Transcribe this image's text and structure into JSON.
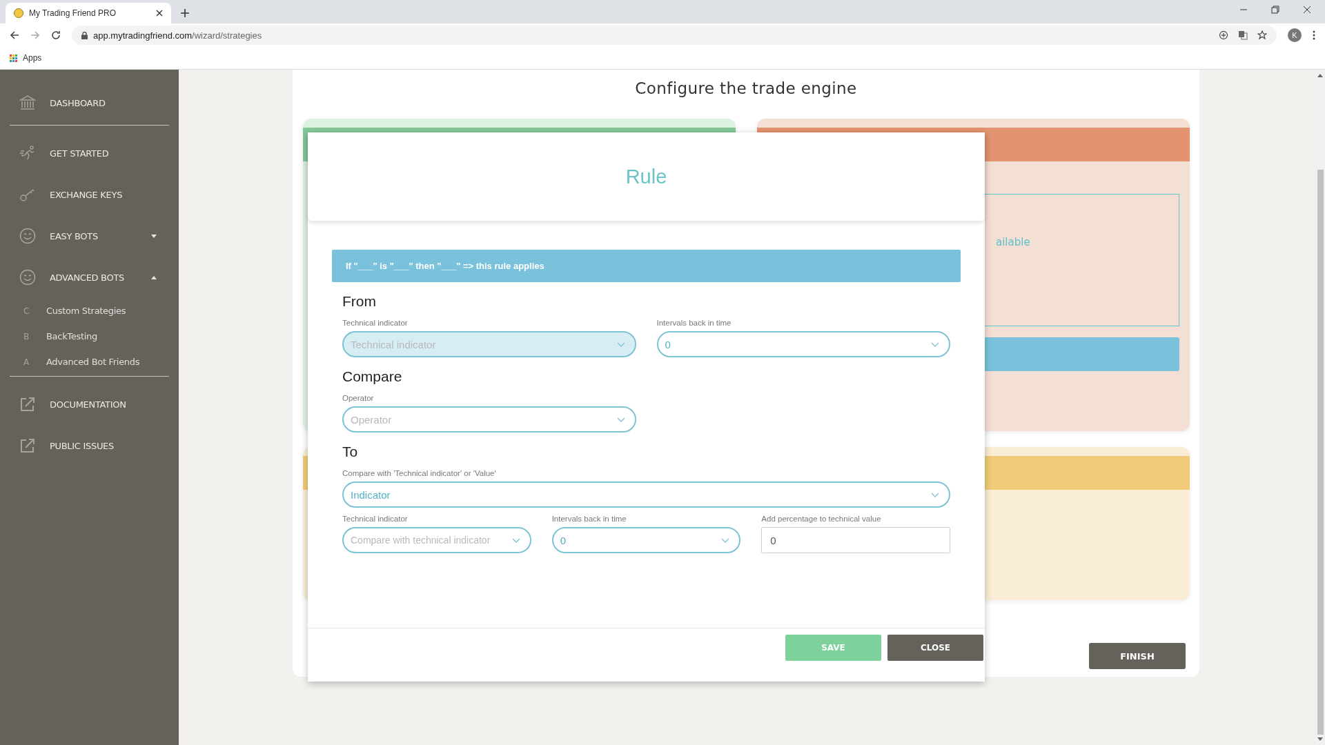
{
  "browser": {
    "tab_title": "My Trading Friend PRO",
    "url_host": "app.mytradingfriend.com",
    "url_path": "/wizard/strategies",
    "bookmarks": [
      "Apps"
    ],
    "avatar": "K"
  },
  "sidebar": {
    "groups": [
      [
        {
          "kind": "main",
          "label": "DASHBOARD"
        }
      ],
      [
        {
          "kind": "main",
          "label": "GET STARTED"
        },
        {
          "kind": "main",
          "label": "EXCHANGE KEYS"
        },
        {
          "kind": "main",
          "label": "EASY BOTS",
          "expanded": false
        },
        {
          "kind": "main",
          "label": "ADVANCED BOTS",
          "expanded": true
        },
        {
          "kind": "sub",
          "letter": "C",
          "label": "Custom Strategies"
        },
        {
          "kind": "sub",
          "letter": "B",
          "label": "BackTesting"
        },
        {
          "kind": "sub",
          "letter": "A",
          "label": "Advanced Bot Friends"
        }
      ],
      [
        {
          "kind": "main",
          "label": "DOCUMENTATION"
        },
        {
          "kind": "main",
          "label": "PUBLIC ISSUES"
        }
      ]
    ]
  },
  "page": {
    "title": "Configure the trade engine",
    "cut_text": "ailable",
    "finish_button": "FINISH"
  },
  "modal": {
    "title": "Rule",
    "hint": "If \"___\" is \"___\" then \"___\" => this rule applies",
    "sections": [
      {
        "heading": "From",
        "rows": [
          [
            {
              "kind": "select",
              "label": "Technical indicator",
              "placeholder": "Technical indicator",
              "focused": true
            },
            {
              "kind": "select",
              "label": "Intervals back in time",
              "value": "0",
              "focused": false
            }
          ]
        ]
      },
      {
        "heading": "Compare",
        "rows": [
          [
            {
              "kind": "select",
              "label": "Operator",
              "placeholder": "Operator",
              "focused": false
            },
            {
              "kind": "spacer"
            }
          ]
        ]
      },
      {
        "heading": "To",
        "rows": [
          [
            {
              "kind": "select",
              "label": "Compare with 'Technical indicator' or 'Value'",
              "value": "Indicator",
              "focused": false
            }
          ],
          [
            {
              "kind": "select",
              "label": "Technical indicator",
              "placeholder": "Compare with technical indicator",
              "focused": false
            },
            {
              "kind": "select",
              "label": "Intervals back in time",
              "value": "0",
              "focused": false
            },
            {
              "kind": "input",
              "label": "Add percentage to technical value",
              "value": "0"
            }
          ]
        ]
      }
    ],
    "buttons": [
      {
        "kind": "primary",
        "label": "SAVE"
      },
      {
        "kind": "secondary",
        "label": "CLOSE"
      }
    ]
  }
}
